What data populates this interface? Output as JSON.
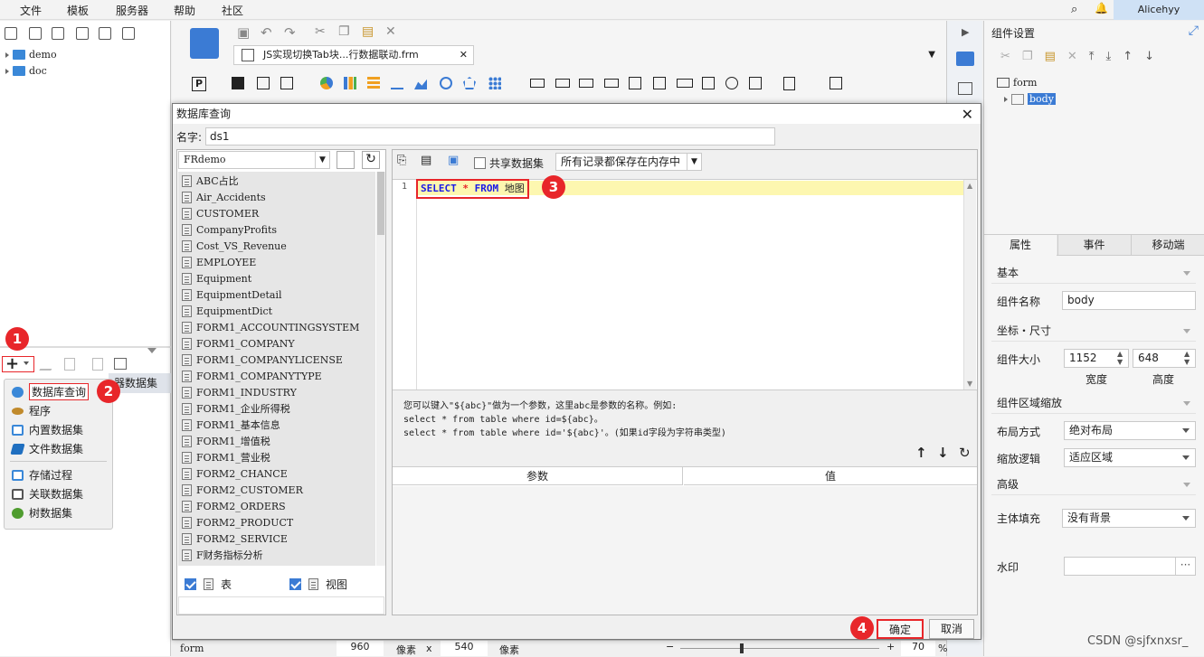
{
  "menu": {
    "items": [
      "文件",
      "模板",
      "服务器",
      "帮助",
      "社区"
    ],
    "user": "Alicehyy"
  },
  "left": {
    "tree": [
      {
        "label": "demo"
      },
      {
        "label": "doc"
      }
    ],
    "partial_label": "器数据集",
    "ds_menu": [
      {
        "label": "数据库查询",
        "icon": "database-icon",
        "color": "#3a88d8"
      },
      {
        "label": "程序",
        "icon": "program-icon",
        "color": "#c08a2c"
      },
      {
        "label": "内置数据集",
        "icon": "builtin-dataset-icon",
        "color": "#3a88d8"
      },
      {
        "label": "文件数据集",
        "icon": "file-dataset-icon",
        "color": "#1f6fc0"
      },
      {
        "label": "存储过程",
        "icon": "stored-procedure-icon",
        "color": "#3a88d8"
      },
      {
        "label": "关联数据集",
        "icon": "relation-dataset-icon",
        "color": "#555555"
      },
      {
        "label": "树数据集",
        "icon": "tree-dataset-icon",
        "color": "#4f9c2f"
      }
    ]
  },
  "tab": {
    "title": "JS实现切换Tab块...行数据联动.frm"
  },
  "dialog": {
    "title": "数据库查询",
    "name_label": "名字:",
    "name_value": "ds1",
    "connection": "FRdemo",
    "tables": [
      "ABC占比",
      "Air_Accidents",
      "CUSTOMER",
      "CompanyProfits",
      "Cost_VS_Revenue",
      "EMPLOYEE",
      "Equipment",
      "EquipmentDetail",
      "EquipmentDict",
      "FORM1_ACCOUNTINGSYSTEM",
      "FORM1_COMPANY",
      "FORM1_COMPANYLICENSE",
      "FORM1_COMPANYTYPE",
      "FORM1_INDUSTRY",
      "FORM1_企业所得税",
      "FORM1_基本信息",
      "FORM1_增值税",
      "FORM1_营业税",
      "FORM2_CHANCE",
      "FORM2_CUSTOMER",
      "FORM2_ORDERS",
      "FORM2_PRODUCT",
      "FORM2_SERVICE",
      "F财务指标分析"
    ],
    "check_table": "表",
    "check_view": "视图",
    "share_label": "共享数据集",
    "cache_option": "所有记录都保存在内存中",
    "line_number": "1",
    "sql_keyword1": "SELECT",
    "sql_star": "*",
    "sql_keyword2": "FROM",
    "sql_table": "地图",
    "hint_line1": "您可以键入\"${abc}\"做为一个参数，这里abc是参数的名称。例如:",
    "hint_line2": "select * from table where id=${abc}。",
    "hint_line3": "select * from table where id='${abc}'。(如果id字段为字符串类型)",
    "param_col": "参数",
    "value_col": "值",
    "ok": "确定",
    "cancel": "取消"
  },
  "badges": [
    "1",
    "2",
    "3",
    "4"
  ],
  "status": {
    "form": "form",
    "width": "960",
    "unit1": "像素",
    "x": "x",
    "height": "540",
    "unit2": "像素",
    "zoom": "70",
    "percent": "%"
  },
  "right": {
    "title": "组件设置",
    "tree_root": "form",
    "tree_child": "body",
    "tabs": [
      "属性",
      "事件",
      "移动端"
    ],
    "sec_basic": "基本",
    "name_label": "组件名称",
    "name_value": "body",
    "sec_coord": "坐标・尺寸",
    "size_label": "组件大小",
    "width": "1152",
    "height": "648",
    "width_label": "宽度",
    "height_label": "高度",
    "sec_zoom": "组件区域缩放",
    "layout_label": "布局方式",
    "layout_value": "绝对布局",
    "scale_label": "缩放逻辑",
    "scale_value": "适应区域",
    "sec_adv": "高级",
    "fill_label": "主体填充",
    "fill_value": "没有背景",
    "watermark_label": "水印"
  },
  "watermark": "CSDN @sjfxnxsr_",
  "colors": {
    "accent": "#3b7bd4",
    "badge": "#e8262a",
    "highlight": "#fdf7b0",
    "sql_keyword": "#1a1ae6",
    "sql_star": "#e8262a"
  }
}
